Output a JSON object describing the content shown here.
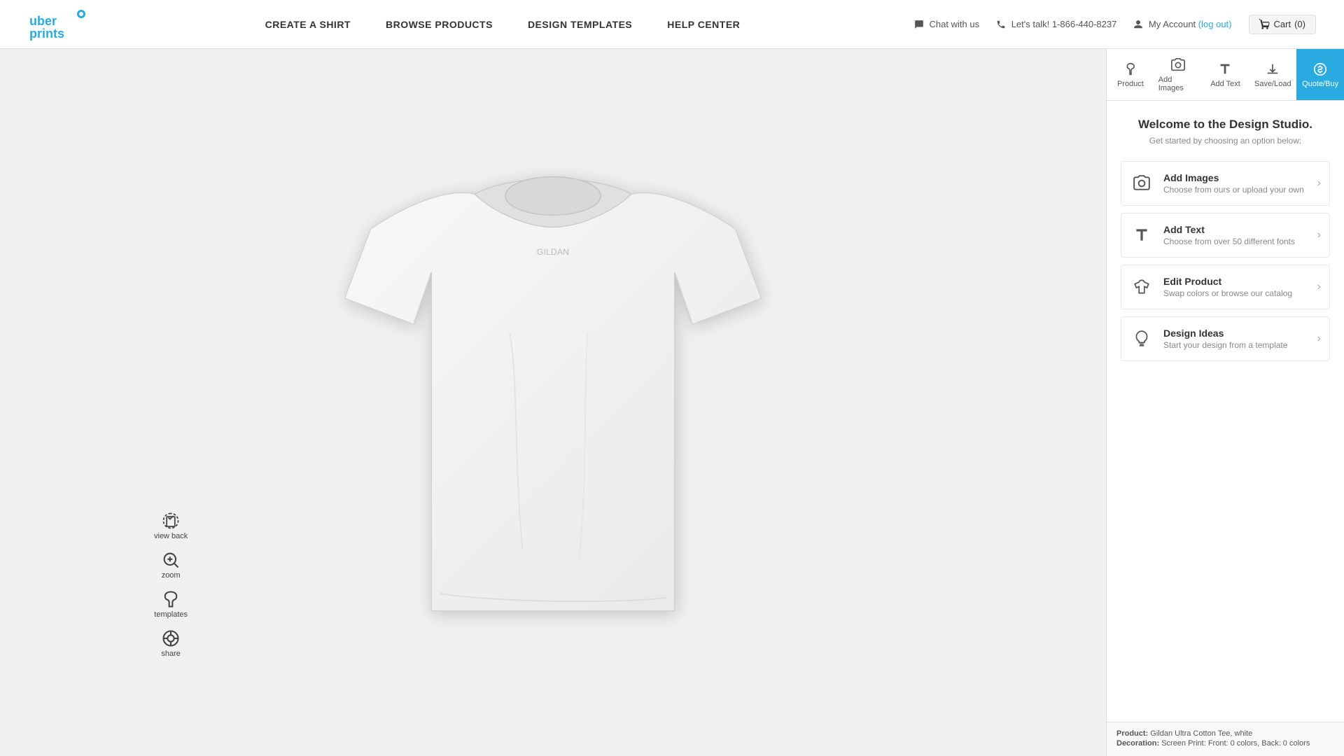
{
  "header": {
    "logo_text": "uber",
    "logo_text2": "prints",
    "chat_label": "Chat with us",
    "phone_label": "Let's talk! 1-866-440-8237",
    "account_label": "My Account",
    "logout_label": "log out",
    "cart_label": "Cart",
    "cart_count": "(0)",
    "nav": [
      {
        "id": "create",
        "label": "CREATE A SHIRT"
      },
      {
        "id": "browse",
        "label": "BROWSE PRODUCTS"
      },
      {
        "id": "design",
        "label": "DESIGN TEMPLATES"
      },
      {
        "id": "help",
        "label": "HELP CENTER"
      }
    ]
  },
  "toolbar": {
    "tabs": [
      {
        "id": "product",
        "label": "Product",
        "icon": "shirt"
      },
      {
        "id": "add-images",
        "label": "Add Images",
        "icon": "camera"
      },
      {
        "id": "add-text",
        "label": "Add Text",
        "icon": "text"
      },
      {
        "id": "save-load",
        "label": "Save/Load",
        "icon": "download"
      },
      {
        "id": "quote-buy",
        "label": "Quote/Buy",
        "icon": "dollar",
        "active": true
      }
    ]
  },
  "welcome": {
    "title": "Welcome to the Design Studio.",
    "subtitle": "Get started by choosing an option below:"
  },
  "menu_items": [
    {
      "id": "add-images",
      "title": "Add Images",
      "subtitle": "Choose from ours or upload your own",
      "icon": "camera"
    },
    {
      "id": "add-text",
      "title": "Add Text",
      "subtitle": "Choose from over 50 different fonts",
      "icon": "text"
    },
    {
      "id": "edit-product",
      "title": "Edit Product",
      "subtitle": "Swap colors or browse our catalog",
      "icon": "shirt"
    },
    {
      "id": "design-ideas",
      "title": "Design Ideas",
      "subtitle": "Start your design from a template",
      "icon": "lightbulb"
    }
  ],
  "left_tools": [
    {
      "id": "view-back",
      "label": "view back",
      "icon": "shirt-back"
    },
    {
      "id": "zoom",
      "label": "zoom",
      "icon": "zoom"
    },
    {
      "id": "templates",
      "label": "templates",
      "icon": "templates"
    },
    {
      "id": "share",
      "label": "share",
      "icon": "share"
    }
  ],
  "footer": {
    "product_label": "Product:",
    "product_value": "Gildan Ultra Cotton Tee, white",
    "decoration_label": "Decoration:",
    "decoration_value": "Screen Print: Front: 0 colors, Back: 0 colors"
  }
}
